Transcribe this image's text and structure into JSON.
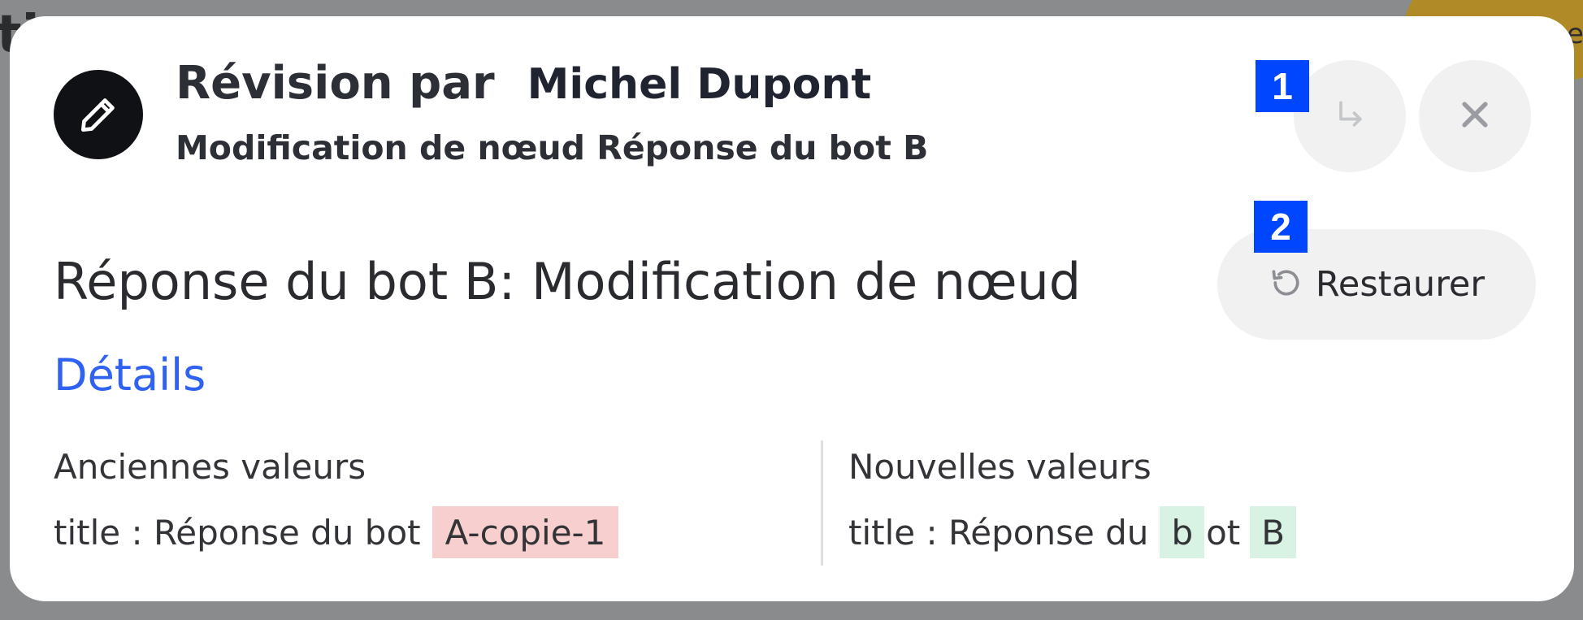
{
  "background": {
    "partial_text": "ti",
    "partial_button_text": "e"
  },
  "modal": {
    "title_prefix": "Révision par",
    "author": "Michel Dupont",
    "subtitle": "Modification de nœud Réponse du bot B",
    "avatar_icon": "pencil-icon",
    "goto_icon": "arrow-turn-down-right-icon",
    "close_icon": "close-icon",
    "markers": [
      "1",
      "2"
    ],
    "heading": "Réponse du bot B: Modification de nœud",
    "restore": {
      "icon": "restore-icon",
      "label": "Restaurer"
    },
    "details_link": "Détails",
    "old_values": {
      "title": "Anciennes valeurs",
      "line_prefix": "title : Réponse du bot",
      "removed": "A-copie-1"
    },
    "new_values": {
      "title": "Nouvelles valeurs",
      "line_prefix": "title : Réponse du",
      "added_1": "b",
      "middle": "ot",
      "added_2": "B"
    }
  },
  "colors": {
    "overlay": "#8a8b8d",
    "link": "#2f62f1",
    "marker": "#0046ff",
    "removed_bg": "#f8cfcf",
    "added_bg": "#d8f3e3"
  }
}
